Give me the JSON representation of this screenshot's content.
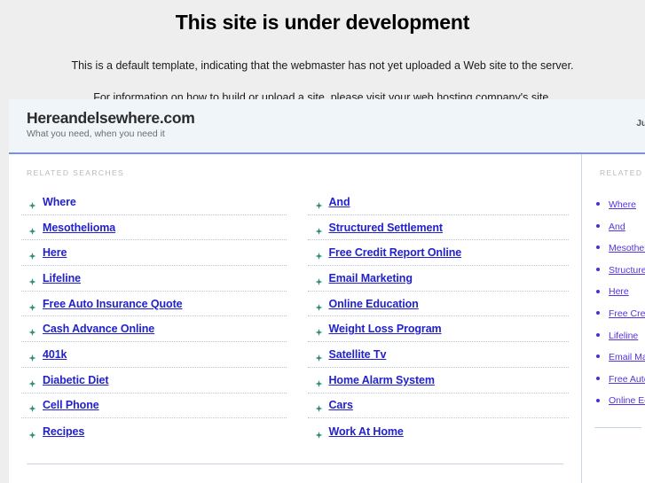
{
  "page": {
    "title": "This site is under development",
    "paragraph1": "This is a default template, indicating that the webmaster has not yet uploaded a Web site to the server.",
    "paragraph2": "For information on how to build or upload a site, please visit your web hosting company's site."
  },
  "frame": {
    "brand": "Hereandelsewhere.com",
    "tagline": "What you need, when you need it",
    "header_right": "Ju",
    "section_label": "RELATED SEARCHES",
    "columns": [
      {
        "items": [
          {
            "label": "Where",
            "underlined": false
          },
          {
            "label": "Mesothelioma",
            "underlined": true
          },
          {
            "label": "Here",
            "underlined": true
          },
          {
            "label": "Lifeline",
            "underlined": true
          },
          {
            "label": "Free Auto Insurance Quote",
            "underlined": true
          },
          {
            "label": "Cash Advance Online",
            "underlined": true
          },
          {
            "label": "401k",
            "underlined": true
          },
          {
            "label": "Diabetic Diet",
            "underlined": true
          },
          {
            "label": "Cell Phone",
            "underlined": true
          },
          {
            "label": "Recipes",
            "underlined": true
          }
        ]
      },
      {
        "items": [
          {
            "label": "And",
            "underlined": true
          },
          {
            "label": "Structured Settlement",
            "underlined": true
          },
          {
            "label": "Free Credit Report Online",
            "underlined": true
          },
          {
            "label": "Email Marketing",
            "underlined": true
          },
          {
            "label": "Online Education",
            "underlined": true
          },
          {
            "label": "Weight Loss Program",
            "underlined": true
          },
          {
            "label": "Satellite Tv",
            "underlined": true
          },
          {
            "label": "Home Alarm System",
            "underlined": true
          },
          {
            "label": "Cars",
            "underlined": true
          },
          {
            "label": "Work At Home",
            "underlined": true
          }
        ]
      }
    ]
  },
  "sidebar": {
    "section_label": "RELATED SEARCHES",
    "items": [
      {
        "label": "Where"
      },
      {
        "label": "And"
      },
      {
        "label": "Mesothelioma"
      },
      {
        "label": "Structured Settlement"
      },
      {
        "label": "Here"
      },
      {
        "label": "Free Credit Report Online"
      },
      {
        "label": "Lifeline"
      },
      {
        "label": "Email Marketing"
      },
      {
        "label": "Free Auto Insurance Quote"
      },
      {
        "label": "Online Education"
      }
    ]
  },
  "colors": {
    "page_background": "#eeeeee",
    "frame_background": "#ffffff",
    "header_background": "#eff5f8",
    "header_underline": "#7b93d6",
    "link": "#2222cc",
    "sidebar_link": "#5533dd",
    "bullet_arrow": "#2e8b7a",
    "sidebar_bullet": "#4a2fd0",
    "section_label": "#b9b9b9",
    "separator": "#b9c6d6"
  },
  "icons": {
    "arrow_bullet": "arrow-bullet-icon",
    "dot_bullet": "dot-bullet-icon"
  }
}
